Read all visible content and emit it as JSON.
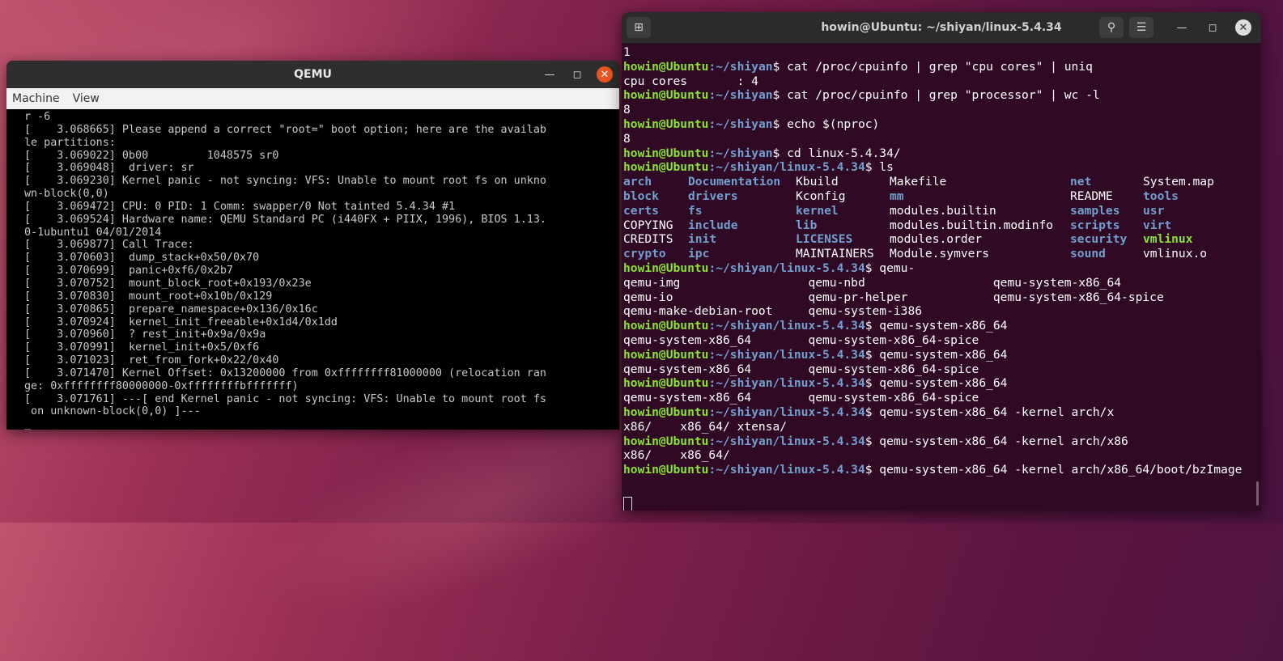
{
  "qemu": {
    "title": "QEMU",
    "menu": [
      "Machine",
      "View"
    ],
    "console": [
      "r -6",
      "[    3.068665] Please append a correct \"root=\" boot option; here are the availab",
      "le partitions:",
      "[    3.069022] 0b00         1048575 sr0",
      "[    3.069048]  driver: sr",
      "[    3.069230] Kernel panic - not syncing: VFS: Unable to mount root fs on unkno",
      "wn-block(0,0)",
      "[    3.069472] CPU: 0 PID: 1 Comm: swapper/0 Not tainted 5.4.34 #1",
      "[    3.069524] Hardware name: QEMU Standard PC (i440FX + PIIX, 1996), BIOS 1.13.",
      "0-1ubuntu1 04/01/2014",
      "[    3.069877] Call Trace:",
      "[    3.070603]  dump_stack+0x50/0x70",
      "[    3.070699]  panic+0xf6/0x2b7",
      "[    3.070752]  mount_block_root+0x193/0x23e",
      "[    3.070830]  mount_root+0x10b/0x129",
      "[    3.070865]  prepare_namespace+0x136/0x16c",
      "[    3.070924]  kernel_init_freeable+0x1d4/0x1dd",
      "[    3.070960]  ? rest_init+0x9a/0x9a",
      "[    3.070991]  kernel_init+0x5/0xf6",
      "[    3.071023]  ret_from_fork+0x22/0x40",
      "[    3.071470] Kernel Offset: 0x13200000 from 0xffffffff81000000 (relocation ran",
      "ge: 0xffffffff80000000-0xffffffffbfffffff)",
      "[    3.071761] ---[ end Kernel panic - not syncing: VFS: Unable to mount root fs",
      " on unknown-block(0,0) ]---",
      "_"
    ]
  },
  "terminal": {
    "title": "howin@Ubuntu: ~/shiyan/linux-5.4.34",
    "prompt_user": "howin@Ubuntu",
    "lines": [
      {
        "kind": "out",
        "text": "1"
      },
      {
        "kind": "prompt",
        "path": ":~/shiyan",
        "cmd": "$ cat /proc/cpuinfo | grep \"cpu cores\" | uniq"
      },
      {
        "kind": "out",
        "text": "cpu cores       : 4"
      },
      {
        "kind": "prompt",
        "path": ":~/shiyan",
        "cmd": "$ cat /proc/cpuinfo | grep \"processor\" | wc -l"
      },
      {
        "kind": "out",
        "text": "8"
      },
      {
        "kind": "prompt",
        "path": ":~/shiyan",
        "cmd": "$ echo $(nproc)"
      },
      {
        "kind": "out",
        "text": "8"
      },
      {
        "kind": "prompt",
        "path": ":~/shiyan",
        "cmd": "$ cd linux-5.4.34/"
      },
      {
        "kind": "prompt",
        "path": ":~/shiyan/linux-5.4.34",
        "cmd": "$ ls"
      },
      {
        "kind": "ls",
        "cells": [
          [
            "arch",
            "d"
          ],
          [
            "Documentation",
            "d"
          ],
          [
            "Kbuild",
            "f"
          ],
          [
            "Makefile",
            "f"
          ],
          [
            "net",
            "d"
          ],
          [
            "System.map",
            "f"
          ]
        ]
      },
      {
        "kind": "ls",
        "cells": [
          [
            "block",
            "d"
          ],
          [
            "drivers",
            "d"
          ],
          [
            "Kconfig",
            "f"
          ],
          [
            "mm",
            "d"
          ],
          [
            "README",
            "f"
          ],
          [
            "tools",
            "d"
          ]
        ]
      },
      {
        "kind": "ls",
        "cells": [
          [
            "certs",
            "d"
          ],
          [
            "fs",
            "d"
          ],
          [
            "kernel",
            "d"
          ],
          [
            "modules.builtin",
            "f"
          ],
          [
            "samples",
            "d"
          ],
          [
            "usr",
            "d"
          ]
        ]
      },
      {
        "kind": "ls",
        "cells": [
          [
            "COPYING",
            "f"
          ],
          [
            "include",
            "d"
          ],
          [
            "lib",
            "d"
          ],
          [
            "modules.builtin.modinfo",
            "f"
          ],
          [
            "scripts",
            "d"
          ],
          [
            "virt",
            "d"
          ]
        ]
      },
      {
        "kind": "ls",
        "cells": [
          [
            "CREDITS",
            "f"
          ],
          [
            "init",
            "d"
          ],
          [
            "LICENSES",
            "d"
          ],
          [
            "modules.order",
            "f"
          ],
          [
            "security",
            "d"
          ],
          [
            "vmlinux",
            "x"
          ]
        ]
      },
      {
        "kind": "ls",
        "cells": [
          [
            "crypto",
            "d"
          ],
          [
            "ipc",
            "d"
          ],
          [
            "MAINTAINERS",
            "f"
          ],
          [
            "Module.symvers",
            "f"
          ],
          [
            "sound",
            "d"
          ],
          [
            "vmlinux.o",
            "f"
          ]
        ]
      },
      {
        "kind": "prompt",
        "path": ":~/shiyan/linux-5.4.34",
        "cmd": "$ qemu-"
      },
      {
        "kind": "out",
        "text": "qemu-img                  qemu-nbd                  qemu-system-x86_64"
      },
      {
        "kind": "out",
        "text": "qemu-io                   qemu-pr-helper            qemu-system-x86_64-spice"
      },
      {
        "kind": "out",
        "text": "qemu-make-debian-root     qemu-system-i386"
      },
      {
        "kind": "prompt",
        "path": ":~/shiyan/linux-5.4.34",
        "cmd": "$ qemu-system-x86_64"
      },
      {
        "kind": "out",
        "text": "qemu-system-x86_64        qemu-system-x86_64-spice"
      },
      {
        "kind": "prompt",
        "path": ":~/shiyan/linux-5.4.34",
        "cmd": "$ qemu-system-x86_64"
      },
      {
        "kind": "out",
        "text": "qemu-system-x86_64        qemu-system-x86_64-spice"
      },
      {
        "kind": "prompt",
        "path": ":~/shiyan/linux-5.4.34",
        "cmd": "$ qemu-system-x86_64"
      },
      {
        "kind": "out",
        "text": "qemu-system-x86_64        qemu-system-x86_64-spice"
      },
      {
        "kind": "prompt",
        "path": ":~/shiyan/linux-5.4.34",
        "cmd": "$ qemu-system-x86_64 -kernel arch/x"
      },
      {
        "kind": "out",
        "text": "x86/    x86_64/ xtensa/"
      },
      {
        "kind": "prompt",
        "path": ":~/shiyan/linux-5.4.34",
        "cmd": "$ qemu-system-x86_64 -kernel arch/x86"
      },
      {
        "kind": "out",
        "text": "x86/    x86_64/"
      },
      {
        "kind": "prompt",
        "path": ":~/shiyan/linux-5.4.34",
        "cmd": "$ qemu-system-x86_64 -kernel arch/x86_64/boot/bzImage"
      },
      {
        "kind": "out",
        "text": ""
      },
      {
        "kind": "cursor"
      }
    ]
  },
  "icons": {
    "new_tab": "new-tab-icon",
    "search": "search-icon",
    "menu": "hamburger-menu-icon",
    "minimize": "minimize-icon",
    "maximize": "maximize-icon",
    "close": "close-icon"
  }
}
